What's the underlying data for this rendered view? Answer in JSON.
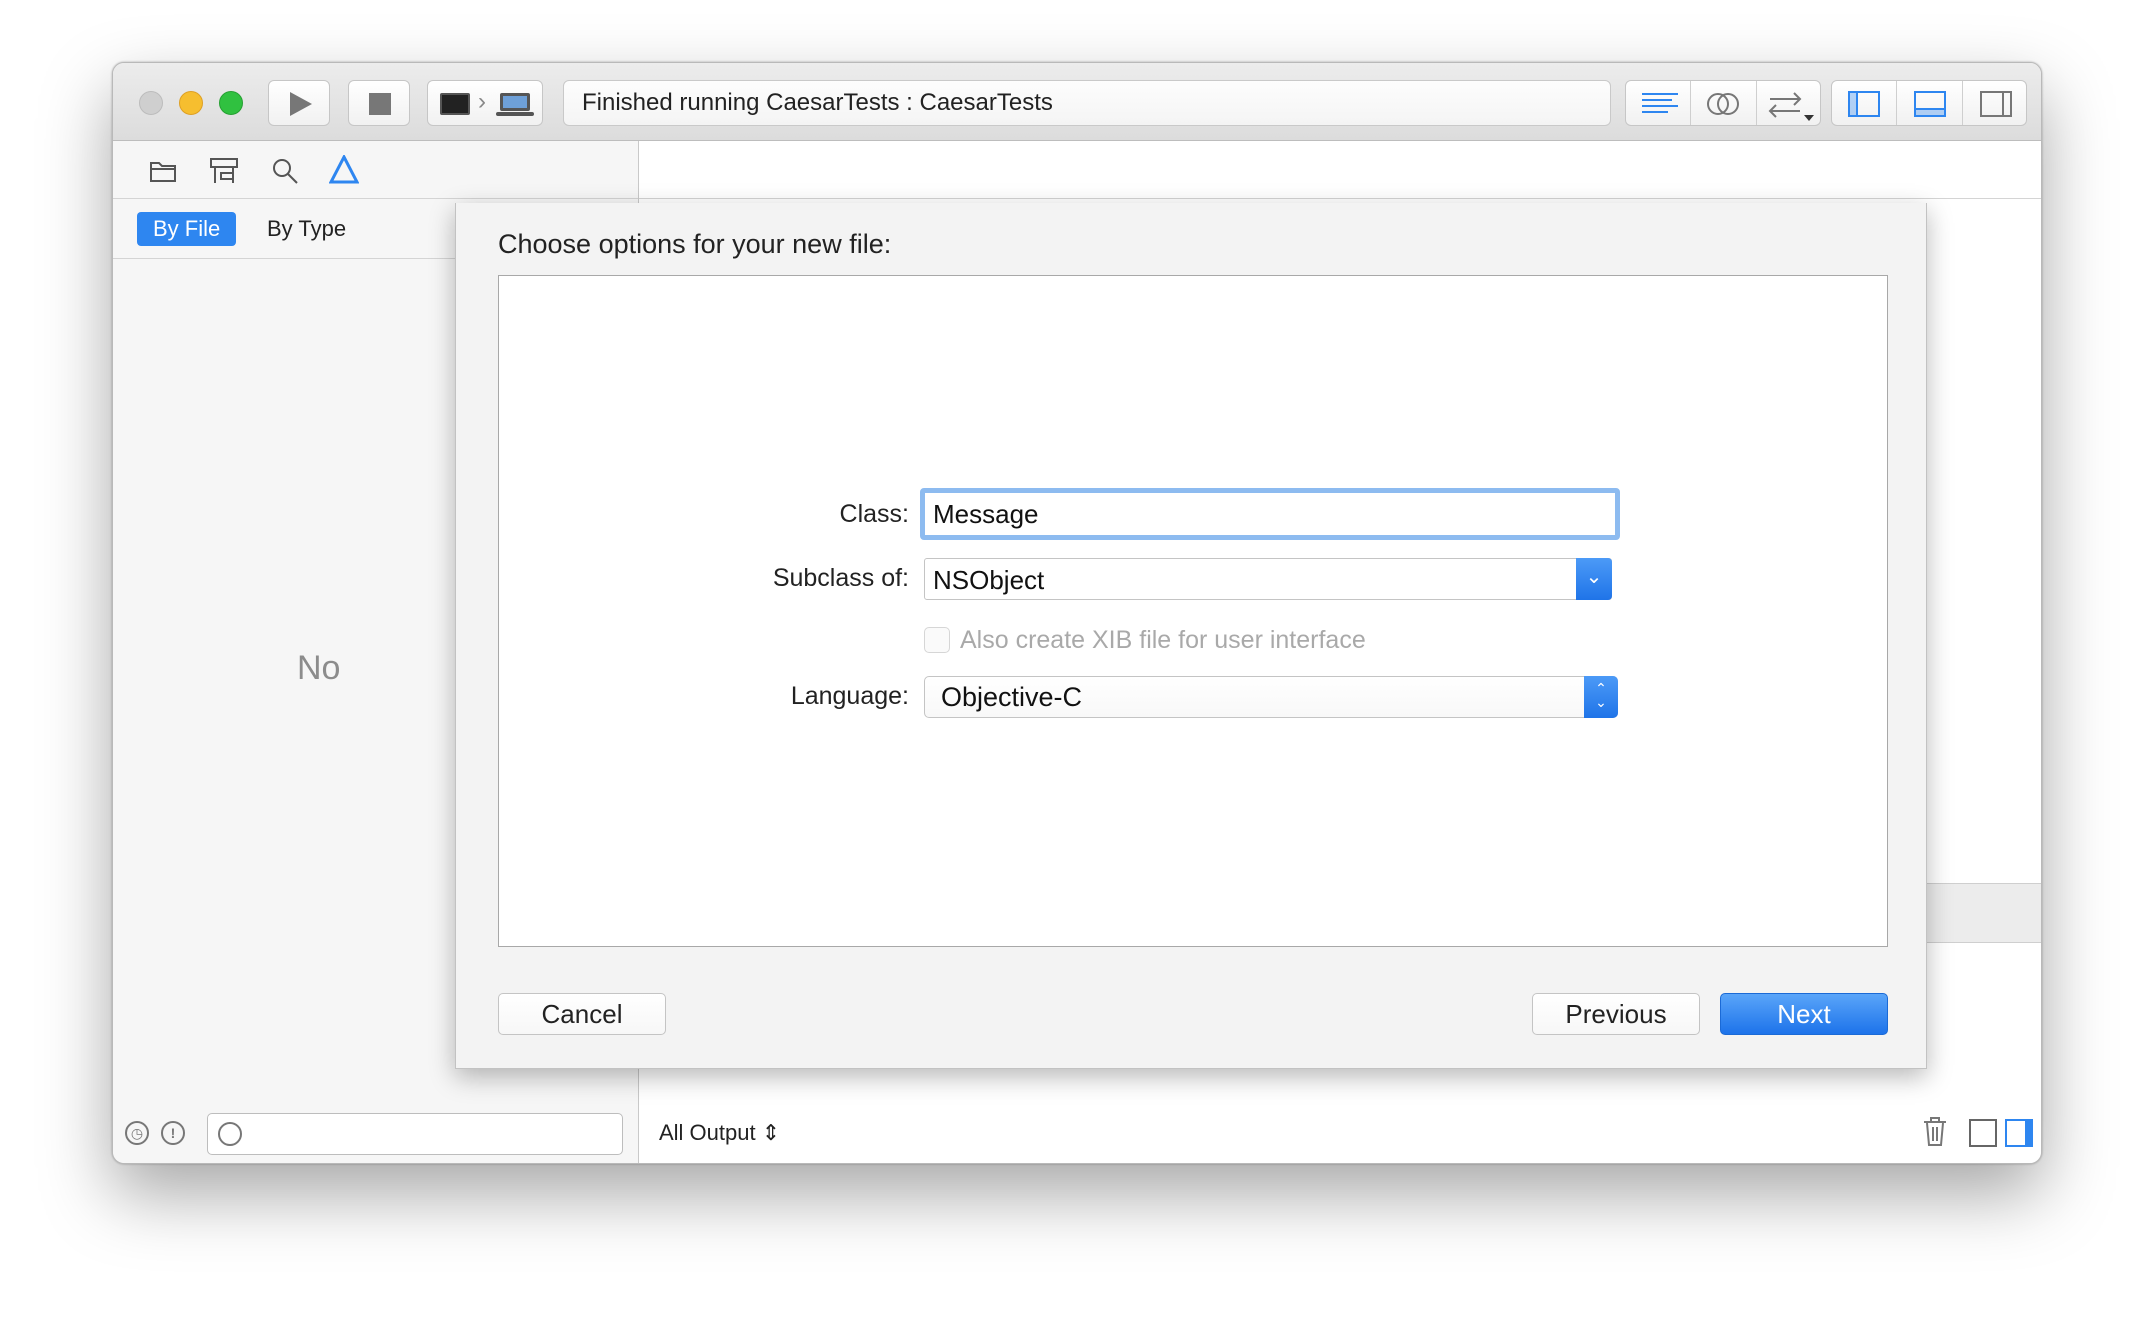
{
  "toolbar": {
    "activity_text": "Finished running CaesarTests : CaesarTests"
  },
  "navigator": {
    "filter_selected": "By File",
    "filter_other": "By Type",
    "empty_text": "No"
  },
  "console": {
    "output_selector": "All Output ⇕"
  },
  "sheet": {
    "title": "Choose options for your new file:",
    "class_label": "Class:",
    "class_value": "Message",
    "subclass_label": "Subclass of:",
    "subclass_value": "NSObject",
    "xib_checkbox_label": "Also create XIB file for user interface",
    "xib_checked": false,
    "language_label": "Language:",
    "language_value": "Objective-C",
    "cancel_label": "Cancel",
    "previous_label": "Previous",
    "next_label": "Next"
  },
  "colors": {
    "accent": "#2e86f0",
    "focus_ring": "#8dbbf0"
  }
}
